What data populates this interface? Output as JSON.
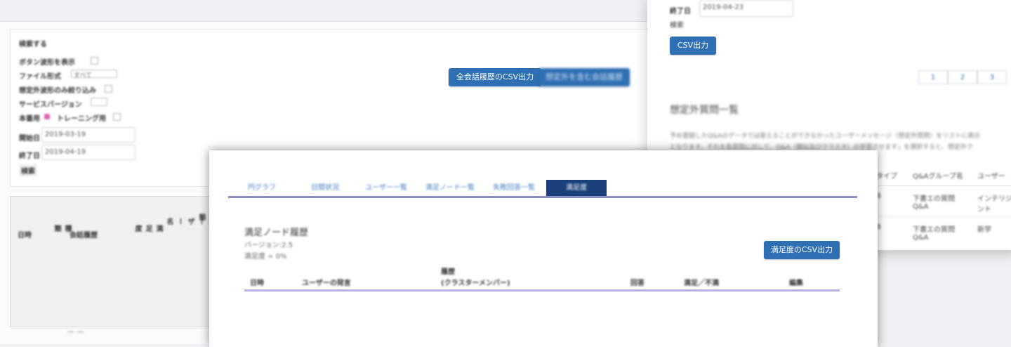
{
  "left_panel": {
    "section_title": "検索する",
    "filters": [
      {
        "label": "ボタン波形を表示",
        "control": "checkbox"
      },
      {
        "label": "ファイル形式",
        "control": "select",
        "value": "すべて"
      },
      {
        "label": "想定外波形のみ絞り込み",
        "control": "checkbox"
      },
      {
        "label": "サービスバージョン",
        "control": "select",
        "value": ""
      }
    ],
    "mode_label": "本番用",
    "training_label": "トレーニング用",
    "start_label": "開始日",
    "start_value": "2019-03-19",
    "end_label": "終了日",
    "end_value": "2019-04-19",
    "search_label": "検索",
    "csv_all_history_label": "全会話履歴のCSV出力",
    "csv_unexpected_label": "想定外を含む会話履歴",
    "table_columns": [
      "日時",
      "種類",
      "会話履歴",
      "満足度",
      "ユーザー名",
      "状態"
    ],
    "bottom_text": "— —"
  },
  "right_panel": {
    "end_label": "終了日",
    "end_value": "2019-04-23",
    "search_label": "検索",
    "csv_button_label": "CSV出力",
    "pagination": [
      "1",
      "2",
      "3"
    ],
    "section_title": "想定外質問一覧",
    "description_line1": "予め登録したQ&Aのデータでは答えることができなかったユーザーメッセージ（想定外質問）をリストに表示",
    "description_line2": "となります。それを各質問に対して、Q&A（類似及びクラスタ）の学習させます」を選択すると、想定外ク",
    "table_headers": [
      "タイプ",
      "Q&Aグループ名",
      "ユーザー"
    ],
    "rows": [
      [
        "B",
        "下書エの質問 Q&A",
        "インテリジェント"
      ],
      [
        "B",
        "下書エの質問 Q&A",
        "新学"
      ]
    ]
  },
  "center_panel": {
    "tabs": [
      {
        "label": "円グラフ",
        "active": false
      },
      {
        "label": "日間状況",
        "active": false
      },
      {
        "label": "ユーザー一覧",
        "active": false
      },
      {
        "label": "満足ノード一覧",
        "active": false
      },
      {
        "label": "失敗回答一覧",
        "active": false
      },
      {
        "label": "満足度",
        "active": true
      }
    ],
    "heading": "満足ノード履歴",
    "version_line": "バージョン:2.5",
    "satisfaction_line": "満足度 = 0%",
    "csv_button_label": "満足度のCSV出力",
    "table_headers": [
      "日時",
      "ユーザーの発言",
      "履歴",
      "(クラスターメンバー)",
      "回答",
      "満足／不満",
      "編集"
    ]
  },
  "colors": {
    "primary_button": "#2f6fb3",
    "active_tab": "#1a3f7a",
    "tab_text": "#3f7cc2",
    "tab_underline": "#8a8fc4",
    "table_underline": "#b3b3e8",
    "pink_radio": "#e063b4"
  }
}
